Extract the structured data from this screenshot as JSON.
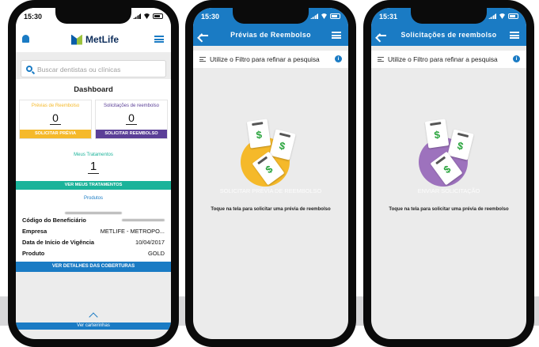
{
  "colors": {
    "brand_blue": "#1a7bc4",
    "yellow": "#f5b92a",
    "purple": "#5b3f97",
    "teal": "#1bb39a",
    "lilac": "#9d72bd"
  },
  "phone1": {
    "time": "15:30",
    "logo_text": "MetLife",
    "search": {
      "placeholder": "Buscar dentistas ou clínicas"
    },
    "dashboard": {
      "title": "Dashboard",
      "previas": {
        "label": "Prévias de Reembolso",
        "count": "0",
        "button": "SOLICITAR PRÉVIA"
      },
      "solicitacoes": {
        "label": "Solicitações de reembolso",
        "count": "0",
        "button": "SOLICITAR REEMBOLSO"
      },
      "tratamentos": {
        "label": "Meus Tratamentos",
        "count": "1",
        "button": "VER MEUS TRATAMENTOS"
      },
      "produtos_label": "Produtos",
      "rows": [
        {
          "key": "Código do Beneficiário",
          "value": ""
        },
        {
          "key": "Empresa",
          "value": "METLIFE - METROPO..."
        },
        {
          "key": "Data de Início de Vigência",
          "value": "10/04/2017"
        },
        {
          "key": "Produto",
          "value": "GOLD"
        }
      ],
      "detail_button": "VER DETALHES DAS COBERTURAS"
    },
    "footer_label": "Ver carteirinhas"
  },
  "phone2": {
    "time": "15:30",
    "title": "Prévias de Reembolso",
    "filter_text": "Utilize o Filtro para refinar a pesquisa",
    "info_glyph": "i",
    "empty_title": "SOLICITAR PRÉVIA DE REEMBOLSO",
    "empty_sub": "Toque na tela para solicitar uma prévia de reembolso",
    "illustration": {
      "dollar": "$"
    }
  },
  "phone3": {
    "time": "15:31",
    "title": "Solicitações de reembolso",
    "filter_text": "Utilize o Filtro para refinar a pesquisa",
    "info_glyph": "i",
    "empty_title": "ENVIAR SOLICITAÇÃO",
    "empty_sub": "Toque na tela para solicitar uma prévia de reembolso",
    "illustration": {
      "dollar": "$"
    }
  }
}
